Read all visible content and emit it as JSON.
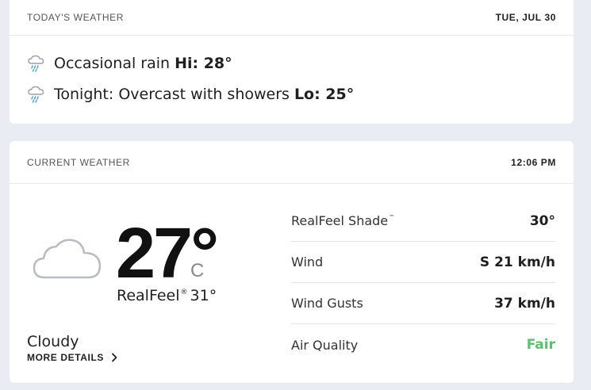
{
  "today": {
    "header_title": "TODAY'S WEATHER",
    "date": "TUE, JUL 30",
    "forecasts": [
      {
        "icon": "rain-icon",
        "text": "Occasional rain",
        "temp": "Hi: 28°"
      },
      {
        "icon": "rain-icon",
        "text": "Tonight: Overcast with showers",
        "temp": "Lo: 25°"
      }
    ]
  },
  "current": {
    "header_title": "CURRENT WEATHER",
    "time": "12:06 PM",
    "icon": "cloud-icon",
    "temperature": "27°",
    "unit": "C",
    "realfeel_label": "RealFeel",
    "realfeel_mark": "®",
    "realfeel_value": "31°",
    "phrase": "Cloudy",
    "more_details": "MORE DETAILS",
    "details": [
      {
        "label": "RealFeel Shade",
        "mark": "™",
        "value": "30°",
        "value_color": "#1f1f1f"
      },
      {
        "label": "Wind",
        "mark": "",
        "value": "S 21 km/h",
        "value_color": "#1f1f1f"
      },
      {
        "label": "Wind Gusts",
        "mark": "",
        "value": "37 km/h",
        "value_color": "#1f1f1f"
      },
      {
        "label": "Air Quality",
        "mark": "",
        "value": "Fair",
        "value_color": "#58c16e"
      }
    ]
  }
}
